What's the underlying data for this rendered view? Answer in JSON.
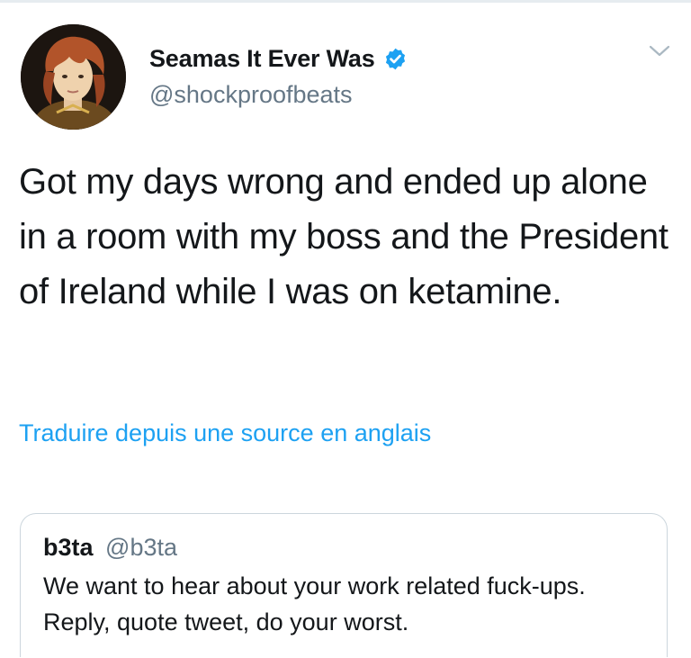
{
  "tweet": {
    "display_name": "Seamas It Ever Was",
    "handle": "@shockproofbeats",
    "verified": true,
    "text": "Got my days wrong and ended up alone in a room with my boss and the President of Ireland while I was on ketamine.",
    "translate_link": "Traduire depuis une source en anglais"
  },
  "quoted_tweet": {
    "display_name": "b3ta",
    "handle": "@b3ta",
    "text": "We want to hear about your work related fuck-ups. Reply, quote tweet, do your worst."
  },
  "icons": {
    "verified": "verified-badge-icon",
    "menu": "chevron-down-icon"
  },
  "colors": {
    "link_blue": "#1da1f2",
    "secondary_text": "#657786",
    "primary_text": "#14171a",
    "border": "#ccd6dd"
  }
}
